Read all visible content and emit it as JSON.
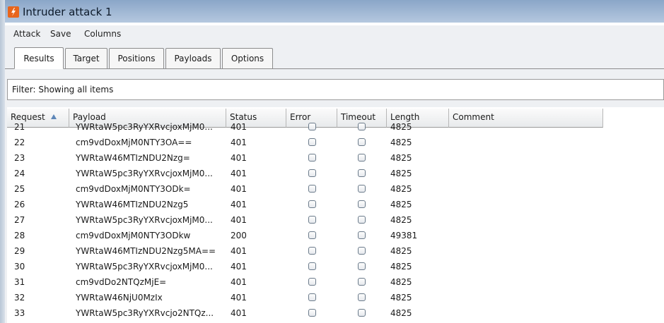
{
  "window": {
    "title": "Intruder attack 1"
  },
  "menu": [
    {
      "name": "menu-attack",
      "label": "Attack"
    },
    {
      "name": "menu-save",
      "label": "Save"
    },
    {
      "name": "menu-columns",
      "label": "Columns"
    }
  ],
  "tabs": [
    {
      "label": "Results",
      "active": true
    },
    {
      "label": "Target"
    },
    {
      "label": "Positions"
    },
    {
      "label": "Payloads"
    },
    {
      "label": "Options"
    }
  ],
  "filter": {
    "text": "Filter: Showing all items"
  },
  "table": {
    "columns": [
      "Request",
      "Payload",
      "Status",
      "Error",
      "Timeout",
      "Length",
      "Comment"
    ],
    "sorted_column": "Request",
    "sort_direction": "ascending",
    "rows": [
      {
        "request": "21",
        "payload": "YWRtaW5pc3RyYXRvcjoxMjM0...",
        "status": "401",
        "error": false,
        "timeout": false,
        "length": "4825",
        "comment": ""
      },
      {
        "request": "22",
        "payload": "cm9vdDoxMjM0NTY3OA==",
        "status": "401",
        "error": false,
        "timeout": false,
        "length": "4825",
        "comment": ""
      },
      {
        "request": "23",
        "payload": "YWRtaW46MTIzNDU2Nzg=",
        "status": "401",
        "error": false,
        "timeout": false,
        "length": "4825",
        "comment": ""
      },
      {
        "request": "24",
        "payload": "YWRtaW5pc3RyYXRvcjoxMjM0...",
        "status": "401",
        "error": false,
        "timeout": false,
        "length": "4825",
        "comment": ""
      },
      {
        "request": "25",
        "payload": "cm9vdDoxMjM0NTY3ODk=",
        "status": "401",
        "error": false,
        "timeout": false,
        "length": "4825",
        "comment": ""
      },
      {
        "request": "26",
        "payload": "YWRtaW46MTIzNDU2Nzg5",
        "status": "401",
        "error": false,
        "timeout": false,
        "length": "4825",
        "comment": ""
      },
      {
        "request": "27",
        "payload": "YWRtaW5pc3RyYXRvcjoxMjM0...",
        "status": "401",
        "error": false,
        "timeout": false,
        "length": "4825",
        "comment": ""
      },
      {
        "request": "28",
        "payload": "cm9vdDoxMjM0NTY3ODkw",
        "status": "200",
        "error": false,
        "timeout": false,
        "length": "49381",
        "comment": ""
      },
      {
        "request": "29",
        "payload": "YWRtaW46MTIzNDU2Nzg5MA==",
        "status": "401",
        "error": false,
        "timeout": false,
        "length": "4825",
        "comment": ""
      },
      {
        "request": "30",
        "payload": "YWRtaW5pc3RyYXRvcjoxMjM0...",
        "status": "401",
        "error": false,
        "timeout": false,
        "length": "4825",
        "comment": ""
      },
      {
        "request": "31",
        "payload": "cm9vdDo2NTQzMjE=",
        "status": "401",
        "error": false,
        "timeout": false,
        "length": "4825",
        "comment": ""
      },
      {
        "request": "32",
        "payload": "YWRtaW46NjU0MzIx",
        "status": "401",
        "error": false,
        "timeout": false,
        "length": "4825",
        "comment": ""
      },
      {
        "request": "33",
        "payload": "YWRtaW5pc3RyYXRvcjo2NTQz...",
        "status": "401",
        "error": false,
        "timeout": false,
        "length": "4825",
        "comment": ""
      }
    ]
  }
}
